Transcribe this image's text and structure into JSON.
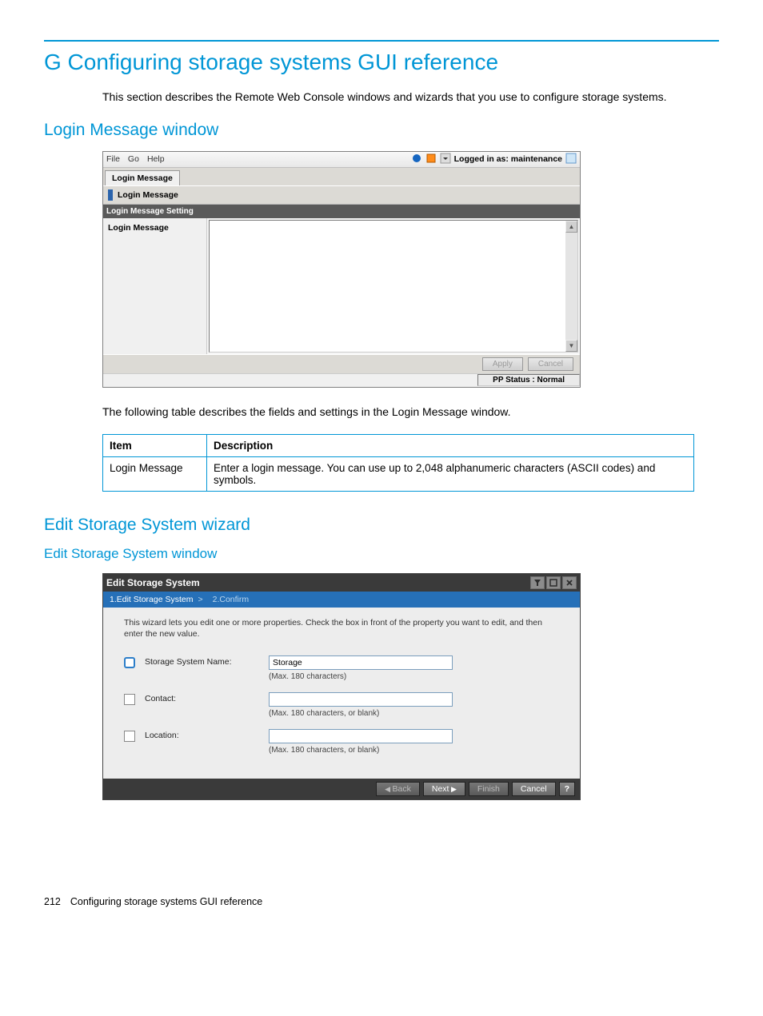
{
  "page": {
    "heading": "G Configuring storage systems GUI reference",
    "intro": "This section describes the Remote Web Console windows and wizards that you use to configure storage systems.",
    "footer_num": "212",
    "footer_text": "Configuring storage systems GUI reference"
  },
  "login_section": {
    "heading": "Login Message window",
    "menu": {
      "file": "File",
      "go": "Go",
      "help": "Help"
    },
    "logged_in_label": "Logged in as: maintenance",
    "tab_active": "Login Message",
    "bar_label": "Login Message",
    "dark_bar": "Login Message Setting",
    "left_label": "Login Message",
    "buttons": {
      "apply": "Apply",
      "cancel": "Cancel"
    },
    "pp_status": "PP Status : Normal",
    "table_caption": "The following table describes the fields and settings in the Login Message window.",
    "table_headers": {
      "item": "Item",
      "desc": "Description"
    },
    "table_row": {
      "item": "Login Message",
      "desc": "Enter a login message. You can use up to 2,048 alphanumeric characters (ASCII codes) and symbols."
    }
  },
  "edit_section": {
    "heading": "Edit Storage System wizard",
    "sub_heading": "Edit Storage System window",
    "title": "Edit Storage System",
    "breadcrumb_step1": "1.Edit Storage System",
    "breadcrumb_sep": ">",
    "breadcrumb_step2": "2.Confirm",
    "instruction": "This wizard lets you edit one or more properties. Check the  box in front of the property you want to edit, and then enter the new value.",
    "fields": {
      "name_label": "Storage System Name:",
      "name_value": "Storage",
      "name_hint": "(Max. 180 characters)",
      "contact_label": "Contact:",
      "contact_value": "",
      "contact_hint": "(Max. 180 characters, or blank)",
      "location_label": "Location:",
      "location_value": "",
      "location_hint": "(Max. 180 characters, or blank)"
    },
    "buttons": {
      "back": "Back",
      "next": "Next",
      "finish": "Finish",
      "cancel": "Cancel",
      "help": "?"
    }
  }
}
